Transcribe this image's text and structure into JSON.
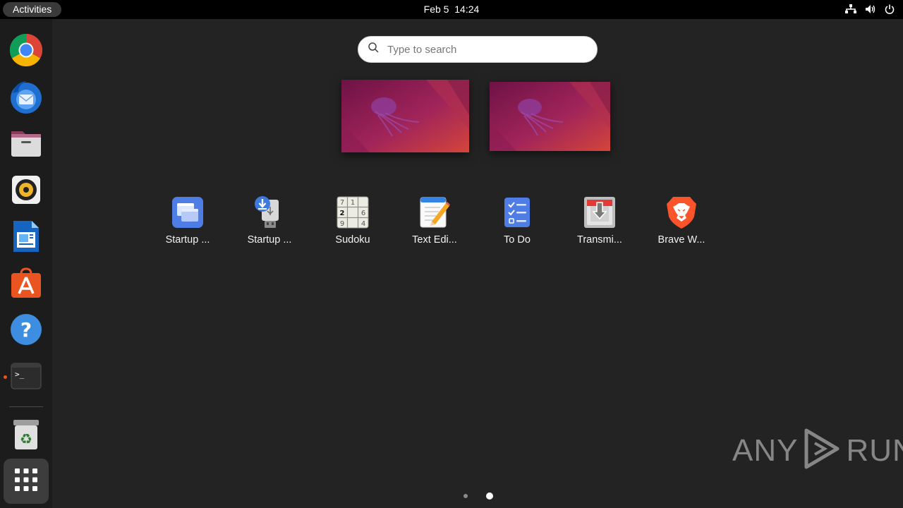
{
  "topbar": {
    "activities_label": "Activities",
    "date": "Feb 5",
    "time": "14:24",
    "tray_icons": [
      "network-icon",
      "volume-icon",
      "power-icon"
    ]
  },
  "dock": {
    "items": [
      {
        "name": "chrome",
        "icon": "chrome-icon"
      },
      {
        "name": "thunderbird",
        "icon": "thunderbird-icon"
      },
      {
        "name": "files",
        "icon": "files-icon"
      },
      {
        "name": "rhythmbox",
        "icon": "rhythmbox-icon"
      },
      {
        "name": "libreoffice-writer",
        "icon": "writer-icon"
      },
      {
        "name": "app-center",
        "icon": "app-center-icon"
      },
      {
        "name": "help",
        "icon": "help-icon"
      },
      {
        "name": "terminal",
        "icon": "terminal-icon",
        "running": true
      },
      {
        "name": "trash",
        "icon": "trash-icon"
      },
      {
        "name": "show-apps",
        "icon": "app-grid-icon"
      }
    ]
  },
  "search": {
    "placeholder": "Type to search",
    "value": ""
  },
  "workspaces": {
    "count": 2,
    "wallpaper": "jellyfish"
  },
  "apps": [
    {
      "label": "Startup ...",
      "icon": "startup-applications-icon"
    },
    {
      "label": "Startup ...",
      "icon": "startup-disk-creator-icon"
    },
    {
      "label": "Sudoku",
      "icon": "sudoku-icon"
    },
    {
      "label": "Text Edi...",
      "icon": "text-editor-icon"
    },
    {
      "label": "To Do",
      "icon": "todo-icon"
    },
    {
      "label": "Transmi...",
      "icon": "transmission-icon"
    },
    {
      "label": "Brave W...",
      "icon": "brave-icon"
    }
  ],
  "sudoku_icon_digits": [
    "7",
    "1",
    "2",
    "6",
    "9",
    "4"
  ],
  "pager": {
    "pages": 2,
    "current": 2
  },
  "watermark": {
    "left": "ANY",
    "right": "RUN"
  },
  "colors": {
    "background": "#232323",
    "dock": "#1c1c1c",
    "accent": "#e95420"
  }
}
